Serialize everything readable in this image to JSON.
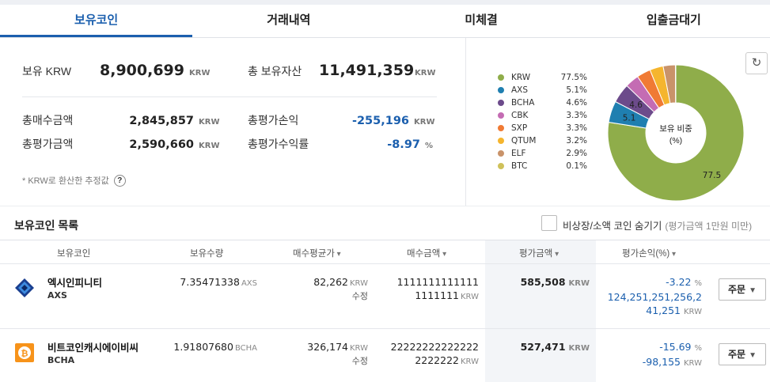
{
  "tabs": [
    {
      "label": "보유코인",
      "active": true
    },
    {
      "label": "거래내역"
    },
    {
      "label": "미체결"
    },
    {
      "label": "입출금대기"
    }
  ],
  "summary": {
    "krw_label": "보유 KRW",
    "krw_value": "8,900,699",
    "krw_unit": "KRW",
    "total_label": "총 보유자산",
    "total_value": "11,491,359",
    "total_unit": "KRW",
    "buy_label": "총매수금액",
    "buy_value": "2,845,857",
    "buy_unit": "KRW",
    "pl_label": "총평가손익",
    "pl_value": "-255,196",
    "pl_unit": "KRW",
    "eval_label": "총평가금액",
    "eval_value": "2,590,660",
    "eval_unit": "KRW",
    "rate_label": "총평가수익률",
    "rate_value": "-8.97",
    "rate_unit": "%",
    "note": "* KRW로 환산한 추정값",
    "help": "?"
  },
  "chart": {
    "center_label_1": "보유 비중",
    "center_label_2": "(%)",
    "refresh_icon": "↻"
  },
  "chart_data": {
    "type": "pie",
    "categories": [
      "KRW",
      "AXS",
      "BCHA",
      "CBK",
      "SXP",
      "QTUM",
      "ELF",
      "BTC"
    ],
    "values": [
      77.5,
      5.1,
      4.6,
      3.3,
      3.3,
      3.2,
      2.9,
      0.1
    ],
    "labels": [
      "77.5%",
      "5.1%",
      "4.6%",
      "3.3%",
      "3.3%",
      "3.2%",
      "2.9%",
      "0.1%"
    ],
    "colors": [
      "#8fad4a",
      "#1f7fb0",
      "#6c4b8b",
      "#c46cb3",
      "#f07a34",
      "#f5b52e",
      "#c9936a",
      "#cfc15a"
    ],
    "slice_labels": {
      "KRW": "77.5",
      "AXS": "5.1",
      "BCHA": "4.6"
    },
    "donut": true
  },
  "list": {
    "title": "보유코인 목록",
    "hide_label": "비상장/소액 코인 숨기기",
    "hide_sub": "(평가금액 1만원 미만)",
    "columns": {
      "coin": "보유코인",
      "qty": "보유수량",
      "avg": "매수평균가",
      "buy": "매수금액",
      "eval": "평가금액",
      "pl": "평가손익(%)"
    },
    "rows": [
      {
        "name": "엑시인피니티",
        "code": "AXS",
        "qty": "7.35471338",
        "qty_unit": "AXS",
        "avg": "82,262",
        "avg_unit": "KRW",
        "avg_fix": "수정",
        "buy_1": "1111111111111",
        "buy_2": "1111111",
        "buy_unit": "KRW",
        "eval": "585,508",
        "eval_unit": "KRW",
        "rate": "-3.22",
        "rate_unit": "%",
        "pl_1": "124,251,251,256,2",
        "pl_2": "41,251",
        "pl_unit": "KRW",
        "order": "주문"
      },
      {
        "name": "비트코인캐시에이비씨",
        "code": "BCHA",
        "qty": "1.91807680",
        "qty_unit": "BCHA",
        "avg": "326,174",
        "avg_unit": "KRW",
        "avg_fix": "수정",
        "buy_1": "22222222222222",
        "buy_2": "2222222",
        "buy_unit": "KRW",
        "eval": "527,471",
        "eval_unit": "KRW",
        "rate": "-15.69",
        "rate_unit": "%",
        "pl_1": "-98,155",
        "pl_unit": "KRW",
        "order": "주문"
      }
    ]
  }
}
